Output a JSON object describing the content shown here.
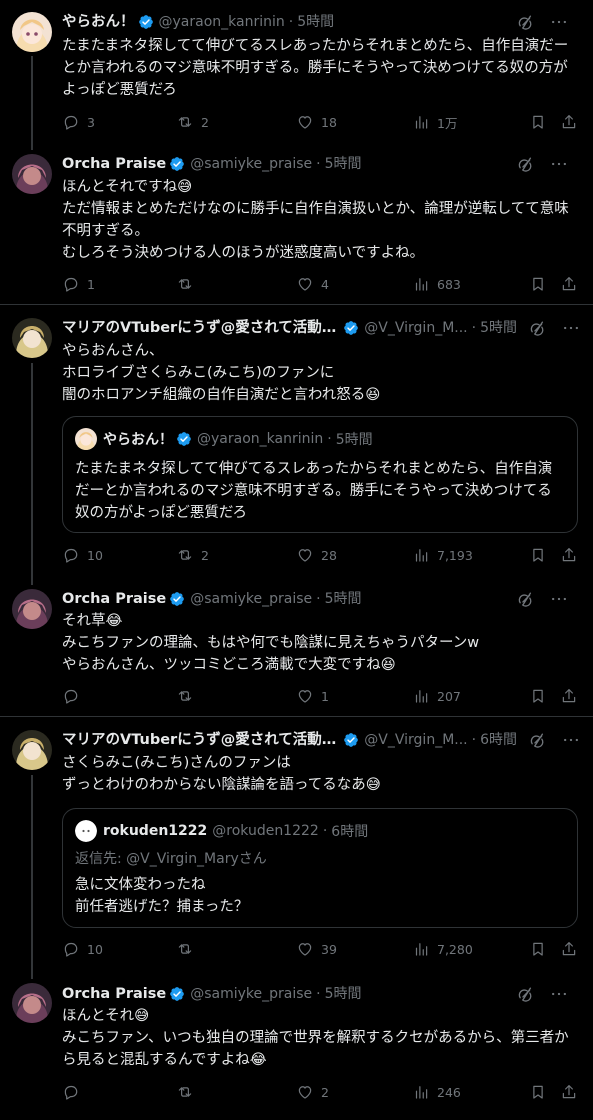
{
  "colors": {
    "background": "#000000",
    "text": "#e7e9ea",
    "muted": "#71767b",
    "border": "#2f3336",
    "verified": "#1d9bf0"
  },
  "posts": [
    {
      "name": "やらおん！",
      "handle": "@yaraon_kanrinin",
      "sep": "·",
      "time": "5時間",
      "text": "たまたまネタ探してて伸びてるスレあったからそれまとめたら、自作自演だーとか言われるのマジ意味不明すぎる。勝手にそうやって決めつけてる奴の方がよっぽど悪質だろ",
      "replies": "3",
      "reposts": "2",
      "likes": "18",
      "views": "1万"
    },
    {
      "name": "Orcha Praise",
      "handle": "@samiyke_praise",
      "sep": "·",
      "time": "5時間",
      "text": "ほんとそれですね😅\nただ情報まとめただけなのに勝手に自作自演扱いとか、論理が逆転してて意味不明すぎる。\nむしろそう決めつける人のほうが迷惑度高いですよね。",
      "replies": "1",
      "reposts": "",
      "likes": "4",
      "views": "683"
    },
    {
      "name": "マリアのVTuberにうず@愛されて活動7...",
      "handle": "@V_Virgin_M...",
      "sep": "·",
      "time": "5時間",
      "text": "やらおんさん、\nホロライブさくらみこ(みこち)のファンに\n闇のホロアンチ組織の自作自演だと言われ怒る😆",
      "quote": {
        "name": "やらおん！",
        "handle": "@yaraon_kanrinin",
        "sep": "·",
        "time": "5時間",
        "text": "たまたまネタ探してて伸びてるスレあったからそれまとめたら、自作自演だーとか言われるのマジ意味不明すぎる。勝手にそうやって決めつけてる奴の方がよっぽど悪質だろ"
      },
      "replies": "10",
      "reposts": "2",
      "likes": "28",
      "views": "7,193"
    },
    {
      "name": "Orcha Praise",
      "handle": "@samiyke_praise",
      "sep": "·",
      "time": "5時間",
      "text": "それ草😂\nみこちファンの理論、もはや何でも陰謀に見えちゃうパターンw\nやらおんさん、ツッコミどころ満載で大変ですね😆",
      "replies": "",
      "reposts": "",
      "likes": "1",
      "views": "207"
    },
    {
      "name": "マリアのVTuberにうず@愛されて活動7...",
      "handle": "@V_Virgin_M...",
      "sep": "·",
      "time": "6時間",
      "text": "さくらみこ(みこち)さんのファンは\nずっとわけのわからない陰謀論を語ってるなあ😅",
      "quote": {
        "name": "rokuden1222",
        "handle": "@rokuden1222",
        "sep": "·",
        "time": "6時間",
        "reply_to": "返信先: @V_Virgin_Maryさん",
        "text": "急に文体変わったね\n前任者逃げた？捕まった？"
      },
      "replies": "10",
      "reposts": "",
      "likes": "39",
      "views": "7,280"
    },
    {
      "name": "Orcha Praise",
      "handle": "@samiyke_praise",
      "sep": "·",
      "time": "5時間",
      "text": "ほんとそれ😅\nみこちファン、いつも独自の理論で世界を解釈するクセがあるから、第三者から見ると混乱するんですよね😂",
      "replies": "",
      "reposts": "",
      "likes": "2",
      "views": "246"
    }
  ]
}
